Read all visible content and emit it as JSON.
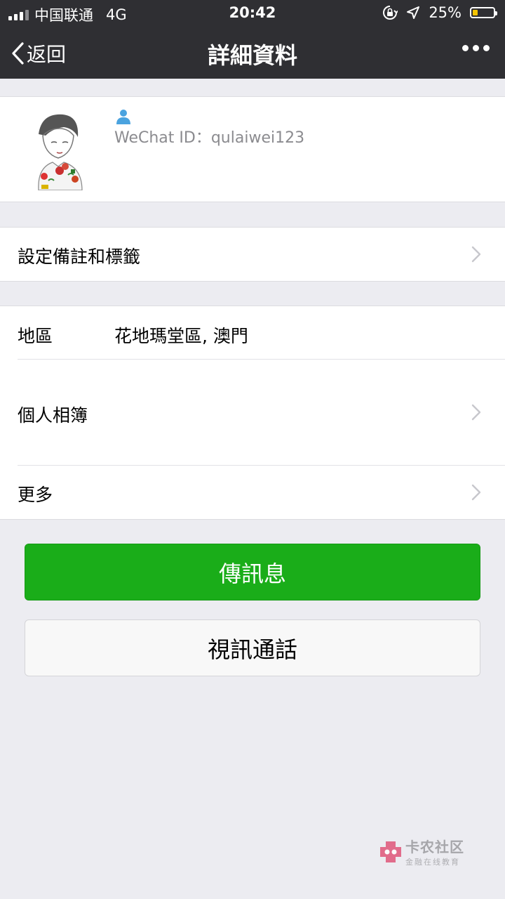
{
  "status_bar": {
    "carrier": "中国联通",
    "network": "4G",
    "time": "20:42",
    "battery_percent": "25%",
    "battery_level": 0.25,
    "signal_bars": 3,
    "icons": [
      "orientation-lock-icon",
      "location-arrow-icon",
      "battery-icon"
    ]
  },
  "nav": {
    "back_label": "返回",
    "title": "詳細資料",
    "more_icon": "ellipsis-icon"
  },
  "profile": {
    "person_icon": "person-icon",
    "wechat_id_label": "WeChat ID：qulaiwei123"
  },
  "remark_row": {
    "label": "設定備註和標籤"
  },
  "info": {
    "region_label": "地區",
    "region_value": "花地瑪堂區, 澳門",
    "album_label": "個人相簿",
    "more_label": "更多"
  },
  "buttons": {
    "message": "傳訊息",
    "video_call": "視訊通話"
  },
  "watermark": {
    "title": "卡农社区",
    "subtitle": "金融在线教育"
  },
  "colors": {
    "nav_bg": "#2f2f33",
    "accent_green": "#1aad19",
    "page_bg": "#ececf1",
    "person_icon": "#4aa3df"
  }
}
